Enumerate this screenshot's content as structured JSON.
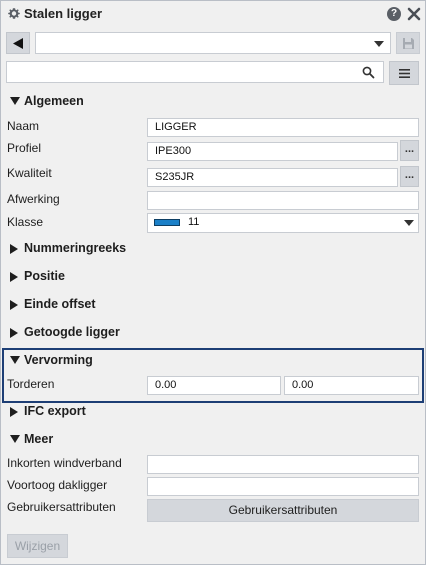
{
  "window": {
    "title": "Stalen ligger",
    "help_label": "?",
    "icons": {
      "settings": "gear-icon",
      "help": "help-icon",
      "close": "close-icon"
    }
  },
  "toolbar": {
    "preset_value": "",
    "search_value": "",
    "icons": {
      "back": "triangle-left-icon",
      "save": "save-icon",
      "search": "search-icon",
      "menu": "hamburger-menu-icon"
    }
  },
  "sections": {
    "algemeen": "Algemeen",
    "nummeringreeks": "Nummeringreeks",
    "positie": "Positie",
    "einde_offset": "Einde offset",
    "getoogde_ligger": "Getoogde ligger",
    "vervorming": "Vervorming",
    "ifc_export": "IFC export",
    "meer": "Meer"
  },
  "algemeen": {
    "naam": {
      "label": "Naam",
      "value": "LIGGER"
    },
    "profiel": {
      "label": "Profiel",
      "value": "IPE300",
      "browse": "..."
    },
    "kwaliteit": {
      "label": "Kwaliteit",
      "value": "S235JR",
      "browse": "..."
    },
    "afwerking": {
      "label": "Afwerking",
      "value": ""
    },
    "klasse": {
      "label": "Klasse",
      "value": "11",
      "color": "#1b80c8"
    }
  },
  "vervorming": {
    "torderen": {
      "label": "Torderen",
      "start": "0.00",
      "end": "0.00"
    }
  },
  "meer": {
    "inkorten": {
      "label": "Inkorten windverband",
      "value": ""
    },
    "voortoog": {
      "label": "Voortoog dakligger",
      "value": ""
    },
    "gebruikersattributen": {
      "label": "Gebruikersattributen",
      "button": "Gebruikersattributen"
    }
  },
  "footer": {
    "modify_button": "Wijzigen"
  },
  "colors": {
    "highlight_border": "#1d3e75",
    "panel_bg": "#f0f0f0",
    "button_bg": "#d4d7dc"
  }
}
